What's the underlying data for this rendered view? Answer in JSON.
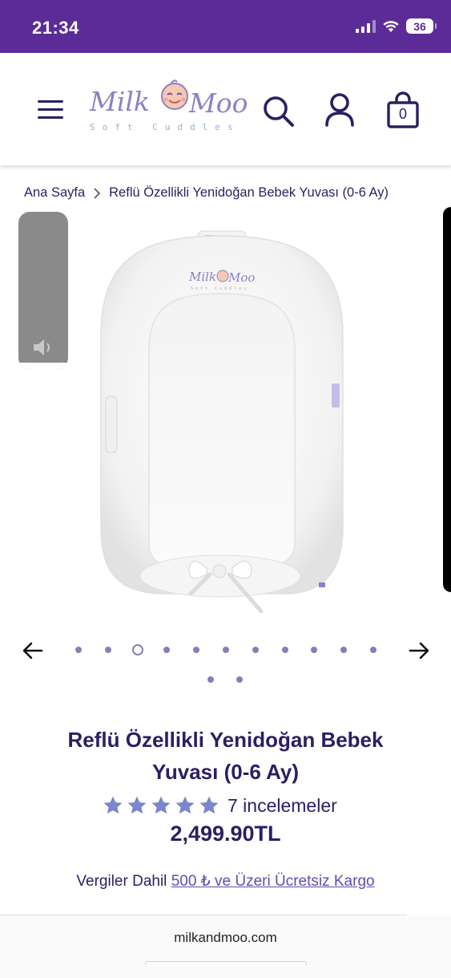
{
  "status_bar": {
    "time": "21:34",
    "battery": "36",
    "icons": [
      "signal-icon",
      "wifi-icon",
      "battery-icon"
    ]
  },
  "header": {
    "logo_text": "MilkMoo",
    "logo_tagline": "Soft Cuddles",
    "cart_count": "0",
    "icons": [
      "menu-icon",
      "search-icon",
      "account-icon",
      "cart-icon"
    ]
  },
  "breadcrumb": {
    "home": "Ana Sayfa",
    "current": "Reflü Özellikli Yenidoğan Bebek Yuvası (0-6 Ay)"
  },
  "gallery": {
    "product_logo_text": "MilkMoo",
    "product_logo_tagline": "Soft Cuddles",
    "total_slides": 13,
    "active_slide_index": 2
  },
  "product": {
    "title": "Reflü Özellikli Yenidoğan Bebek Yuvası (0-6 Ay)",
    "rating": 5,
    "rating_max": 5,
    "review_count": "7 incelemeler",
    "price": "2,499.90TL",
    "tax_text": "Vergiler Dahil",
    "shipping_link": "500 ₺ ve Üzeri Ücretsiz Kargo"
  },
  "browser": {
    "url": "milkandmoo.com"
  },
  "colors": {
    "brand_purple": "#5b2c97",
    "text_dark": "#2d1e62",
    "star": "#7b86cc",
    "link": "#5b4fb0"
  }
}
